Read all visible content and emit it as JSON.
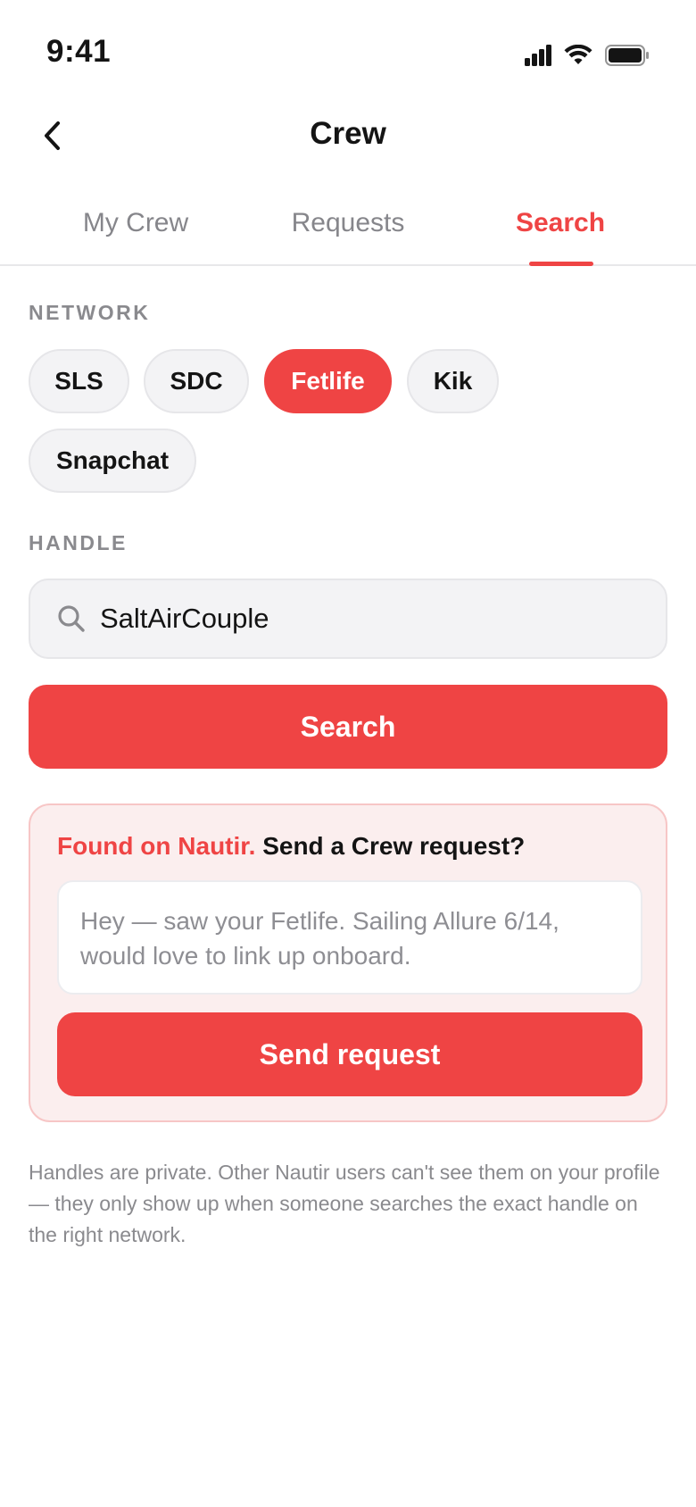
{
  "status_bar": {
    "time": "9:41"
  },
  "nav": {
    "title": "Crew"
  },
  "tabs": [
    {
      "label": "My Crew"
    },
    {
      "label": "Requests"
    },
    {
      "label": "Search",
      "active": true
    }
  ],
  "network": {
    "label": "NETWORK",
    "options": [
      {
        "label": "SLS"
      },
      {
        "label": "SDC"
      },
      {
        "label": "Fetlife",
        "selected": true
      },
      {
        "label": "Kik"
      },
      {
        "label": "Snapchat"
      }
    ]
  },
  "handle": {
    "label": "HANDLE",
    "value": "SaltAirCouple",
    "icon": "search-icon"
  },
  "search_button": {
    "label": "Search"
  },
  "result": {
    "found_label": "Found on Nautir.",
    "prompt": "Send a Crew request?",
    "message_placeholder": "Hey — saw your Fetlife. Sailing Allure 6/14, would love to link up onboard.",
    "send_label": "Send request"
  },
  "footnote": "Handles are private. Other Nautir users can't see them on your profile — they only show up when someone searches the exact handle on the right network.",
  "colors": {
    "accent": "#ef4444",
    "chip_bg": "#f3f3f5",
    "card_bg": "#fbeeee",
    "muted": "#8a8a8e"
  }
}
